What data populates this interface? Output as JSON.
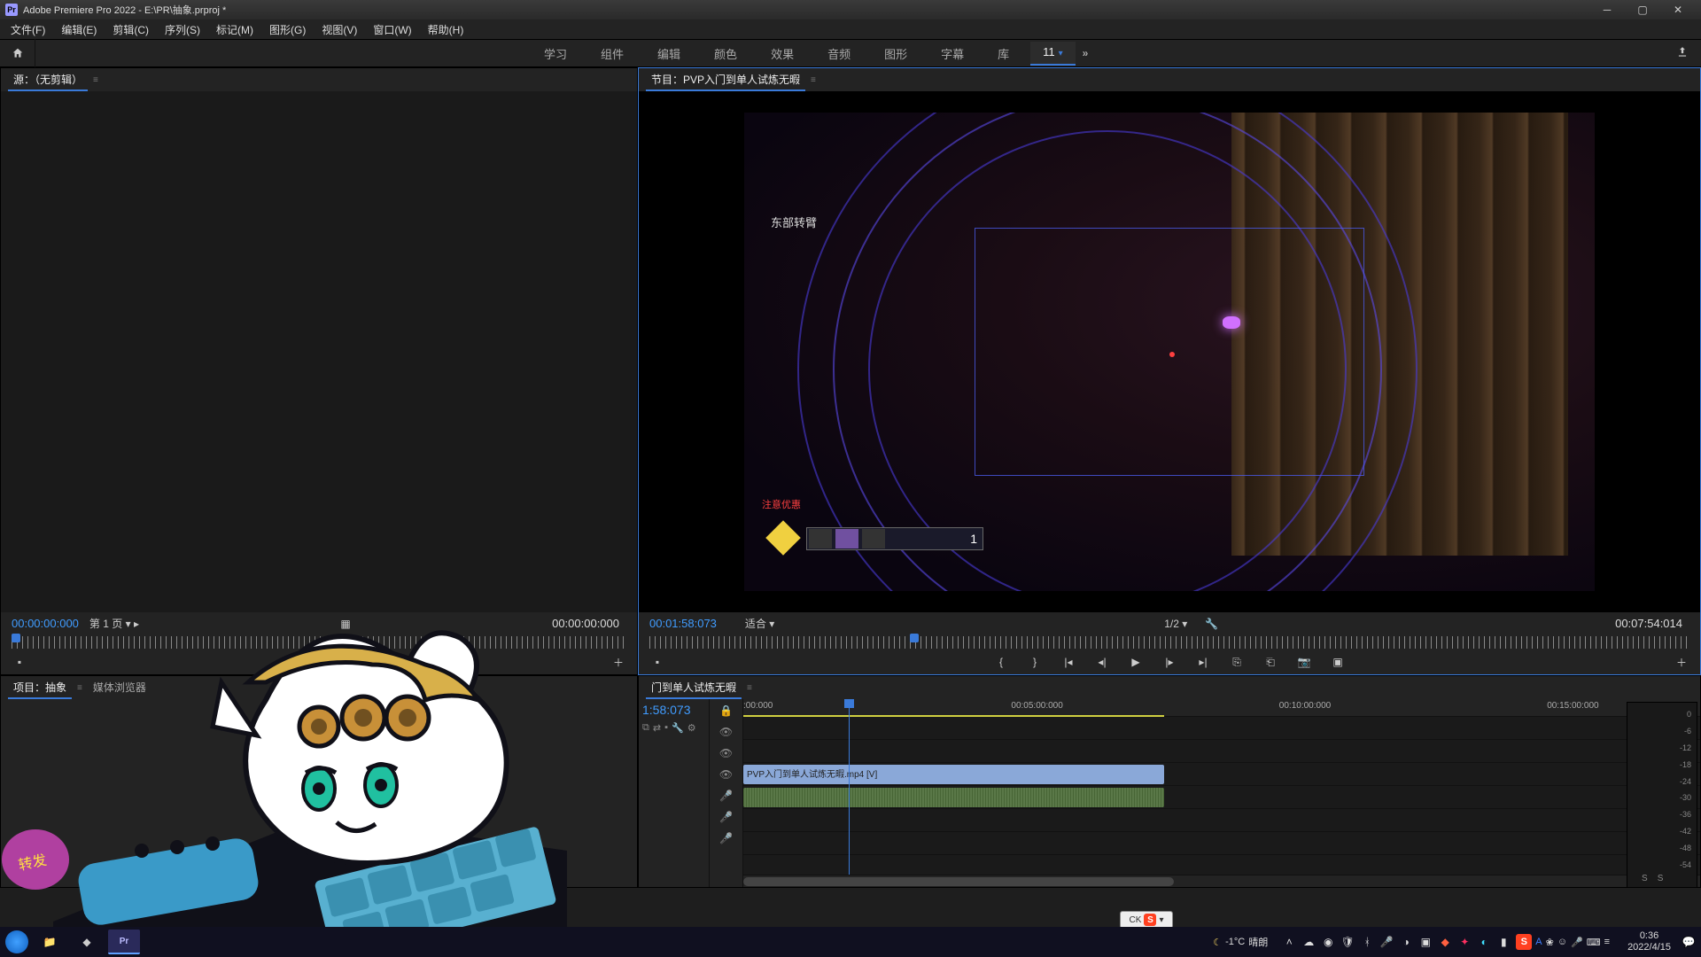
{
  "titlebar": {
    "app": "Adobe Premiere Pro 2022",
    "path": "E:\\PR\\抽象.prproj *"
  },
  "menu": [
    "文件(F)",
    "编辑(E)",
    "剪辑(C)",
    "序列(S)",
    "标记(M)",
    "图形(G)",
    "视图(V)",
    "窗口(W)",
    "帮助(H)"
  ],
  "workspaces": [
    "学习",
    "组件",
    "编辑",
    "颜色",
    "效果",
    "音频",
    "图形",
    "字幕",
    "库",
    "11"
  ],
  "workspace_active": "11",
  "source": {
    "tab": "源：（无剪辑）",
    "tc_in": "00:00:00:000",
    "page": "第 1 页",
    "tc_out": "00:00:00:000"
  },
  "program": {
    "tab_prefix": "节目：",
    "sequence": "PVP入门到单人试炼无暇",
    "tc_current": "00:01:58:073",
    "fit": "适合",
    "resolution": "1/2",
    "tc_total": "00:07:54:014",
    "overlay_label": "东部转臂",
    "hud_number": "1",
    "red_text": "注意优惠"
  },
  "project": {
    "tab_prefix": "项目：",
    "name": "抽象",
    "tab2": "媒体浏览器"
  },
  "timeline": {
    "tab": "门到单人试炼无暇",
    "tc": "1:58:073",
    "ruler": [
      {
        "label": ":00:000",
        "pct": 0
      },
      {
        "label": "00:05:00:000",
        "pct": 28
      },
      {
        "label": "00:10:00:000",
        "pct": 56
      },
      {
        "label": "00:15:00:000",
        "pct": 84
      }
    ],
    "playhead_pct": 11,
    "clip_name": "PVP入门到单人试炼无暇.mp4 [V]",
    "clip_end_pct": 44,
    "marker_end_pct": 44
  },
  "audio_meter": {
    "ticks": [
      "0",
      "-6",
      "-12",
      "-18",
      "-24",
      "-30",
      "-36",
      "-42",
      "-48",
      "-54"
    ],
    "label_left": "S",
    "label_right": "S"
  },
  "ime_popup": "CK",
  "taskbar": {
    "weather_temp": "-1°C",
    "weather_text": "晴朗",
    "time": "0:36",
    "date": "2022/4/15",
    "pr": "Pr"
  }
}
